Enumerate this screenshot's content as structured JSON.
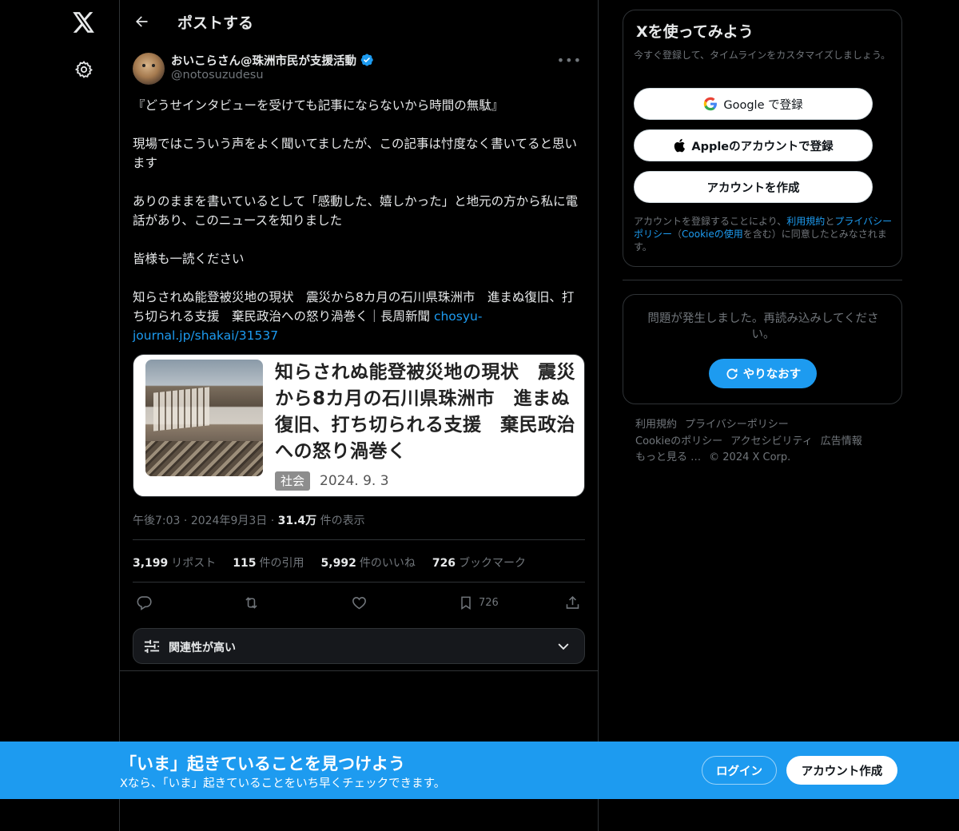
{
  "nav": {
    "logo_icon": "x-logo-icon",
    "settings_icon": "gear-icon"
  },
  "header": {
    "title": "ポストする"
  },
  "post": {
    "author_name": "おいこらさん@珠洲市民が支援活動",
    "author_handle": "@notosuzudesu",
    "body_text": "『どうせインタビューを受けても記事にならないから時間の無駄』\n\n現場ではこういう声をよく聞いてましたが、この記事は忖度なく書いてると思います\n\nありのままを書いているとして「感動した、嬉しかった」と地元の方から私に電話があり、このニュースを知りました\n\n皆様も一読ください\n\n知らされぬ能登被災地の現状　震災から8カ月の石川県珠洲市　進まぬ復旧、打ち切られる支援　棄民政治への怒り渦巻く｜長周新聞 ",
    "link_text": "chosyu-journal.jp/shakai/31537",
    "card": {
      "title": "知らされぬ能登被災地の現状　震災から8カ月の石川県珠洲市　進まぬ復旧、打ち切られる支援　棄民政治への怒り渦巻く",
      "tag": "社会",
      "date": "2024. 9. 3"
    },
    "time": "午後7:03",
    "date": "2024年9月3日",
    "views_value": "31.4万",
    "views_label": "件の表示",
    "stats": {
      "reposts_value": "3,199",
      "reposts_label": "リポスト",
      "quotes_value": "115",
      "quotes_label": "件の引用",
      "likes_value": "5,992",
      "likes_label": "件のいいね",
      "bookmarks_value": "726",
      "bookmarks_label": "ブックマーク"
    },
    "actions": {
      "bookmark_count": "726"
    },
    "relevance_label": "関連性が高い"
  },
  "sidebar": {
    "signup_title": "Xを使ってみよう",
    "signup_sub": "今すぐ登録して、タイムラインをカスタマイズしましょう。",
    "google_label": "Google で登録",
    "apple_label": "Appleのアカウントで登録",
    "create_label": "アカウントを作成",
    "legal_1": "アカウントを登録することにより、",
    "legal_terms": "利用規約",
    "legal_2": "と",
    "legal_privacy": "プライバシーポリシー",
    "legal_3": "（",
    "legal_cookie": "Cookieの使用",
    "legal_4": "を含む）に同意したとみなされます。",
    "error_text": "問題が発生しました。再読み込みしてください。",
    "retry_label": "やりなおす",
    "footer": [
      "利用規約",
      "プライバシーポリシー",
      "Cookieのポリシー",
      "アクセシビリティ",
      "広告情報",
      "もっと見る …",
      "© 2024 X Corp."
    ]
  },
  "banner": {
    "title": "「いま」起きていることを見つけよう",
    "subtitle": "Xなら、「いま」起きていることをいち早くチェックできます。",
    "login_label": "ログイン",
    "signup_label": "アカウント作成"
  },
  "colors": {
    "accent": "#1d9bf0",
    "background": "#000000",
    "border": "#2f3336",
    "muted": "#71767b"
  }
}
